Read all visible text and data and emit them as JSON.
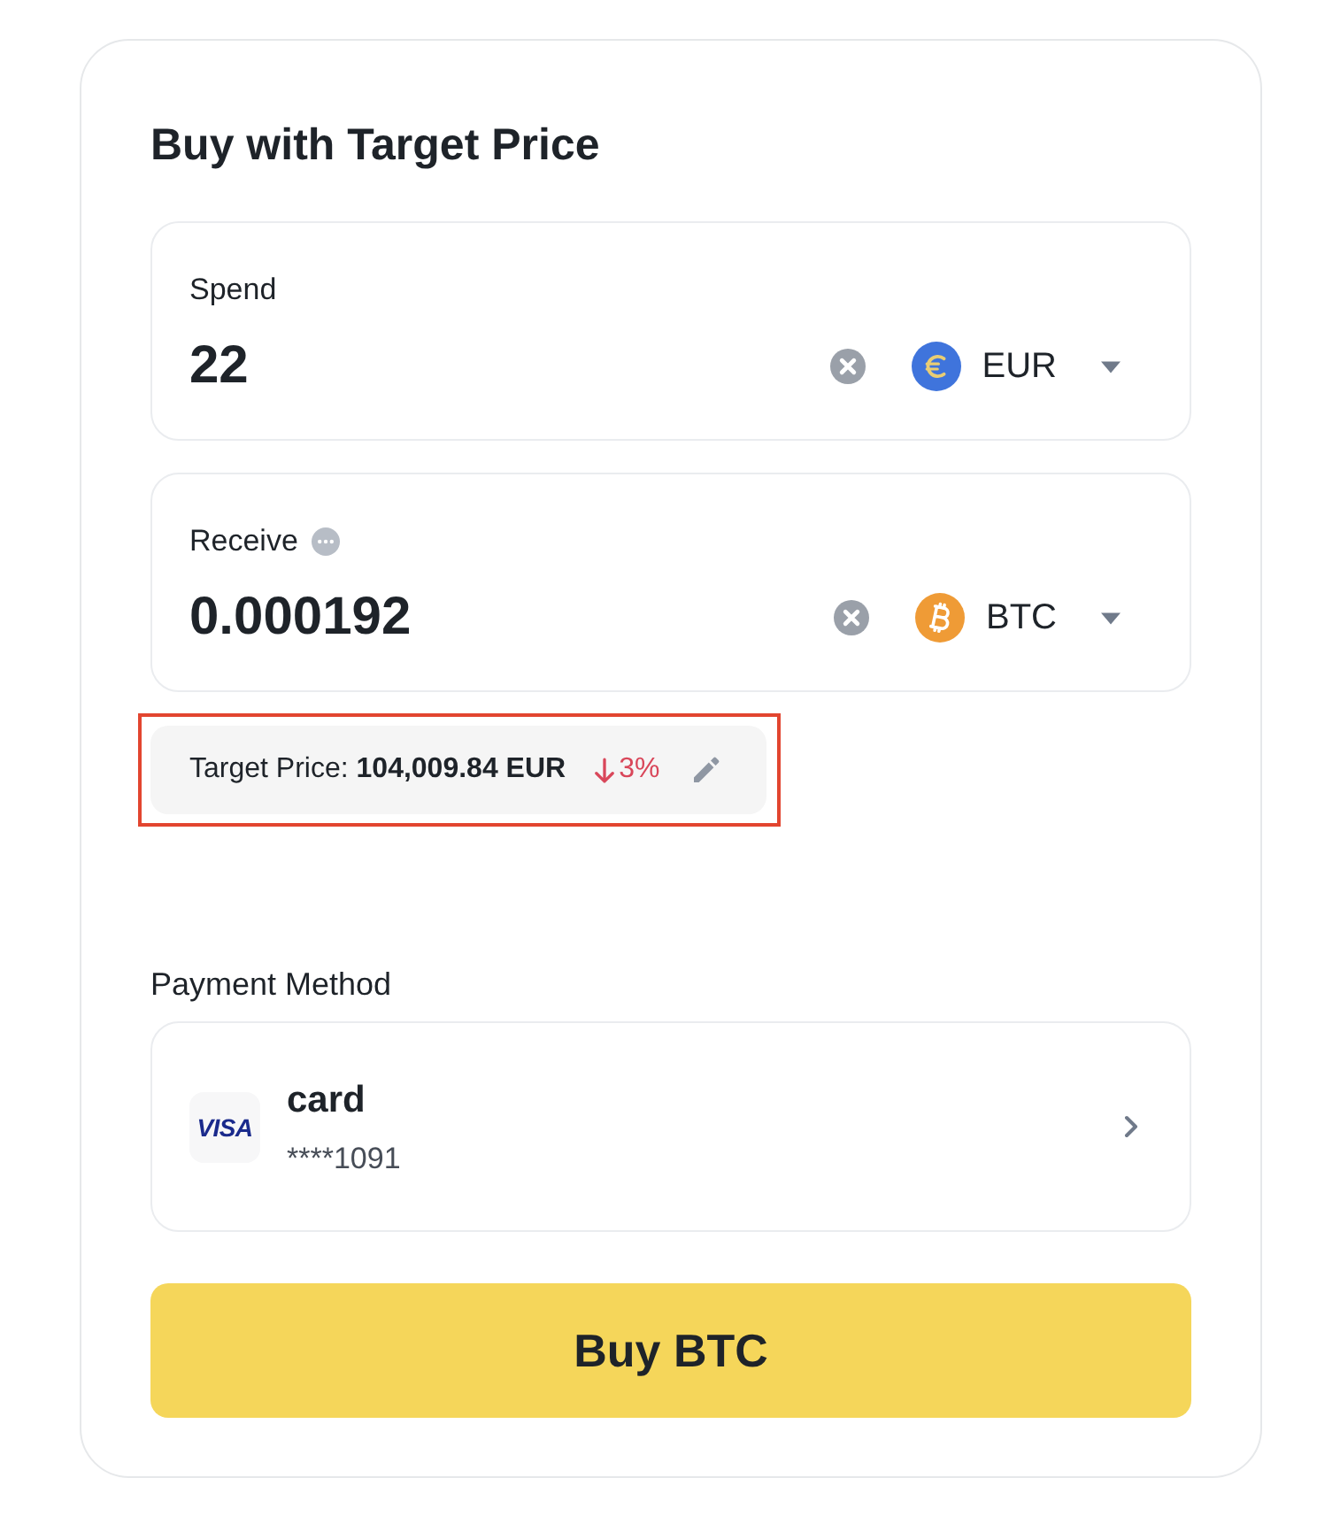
{
  "title": "Buy with Target Price",
  "fields": [
    {
      "label": "Spend",
      "info": false,
      "value": "22",
      "kind": "euro",
      "currency": "EUR"
    },
    {
      "label": "Receive",
      "info": true,
      "value": "0.000192",
      "kind": "bitcoin",
      "currency": "BTC"
    }
  ],
  "target_price": {
    "text": "Target Price: **104,009.84 EUR**",
    "falling": true,
    "change": "3%",
    "highlighted": true
  },
  "payment": {
    "heading": "Payment Method",
    "method": {
      "brand": "VISA",
      "name": "card",
      "number": "****1091"
    }
  },
  "buy_button": "Buy BTC"
}
